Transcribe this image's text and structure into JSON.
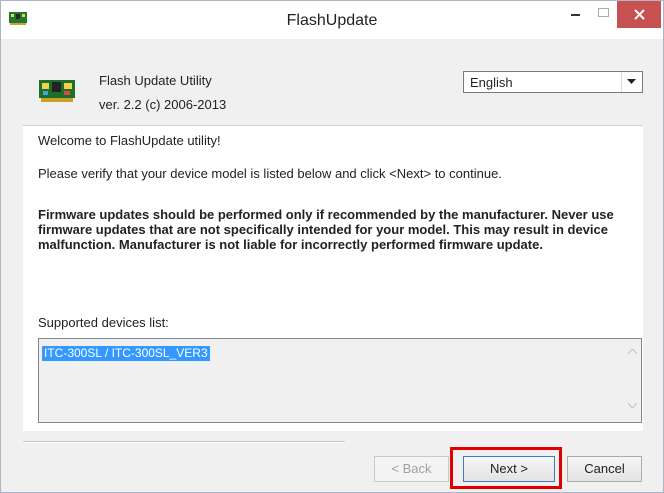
{
  "window": {
    "title": "FlashUpdate"
  },
  "header": {
    "app_title": "Flash Update Utility",
    "version": "ver. 2.2  (c) 2006-2013",
    "language": {
      "selected": "English"
    }
  },
  "content": {
    "welcome": "Welcome to FlashUpdate utility!",
    "instruction": "Please verify that your device model is listed below and click <Next> to continue.",
    "warning": "Firmware updates should be performed only if recommended by the manufacturer. Never use firmware updates that are not specifically intended for your model. This may result in device malfunction. Manufacturer is not liable for incorrectly performed firmware update.",
    "supported_label": "Supported devices list:",
    "devices": [
      "ITC-300SL / ITC-300SL_VER3"
    ]
  },
  "buttons": {
    "back": "< Back",
    "next": "Next >",
    "cancel": "Cancel"
  },
  "colors": {
    "close_button": "#c75050",
    "selection": "#3399ff",
    "highlight": "#e00000"
  },
  "icons": [
    "app-icon",
    "circuit-board-icon",
    "chevron-down-icon",
    "close-icon",
    "minimize-icon",
    "maximize-icon",
    "scroll-up-icon",
    "scroll-down-icon"
  ]
}
